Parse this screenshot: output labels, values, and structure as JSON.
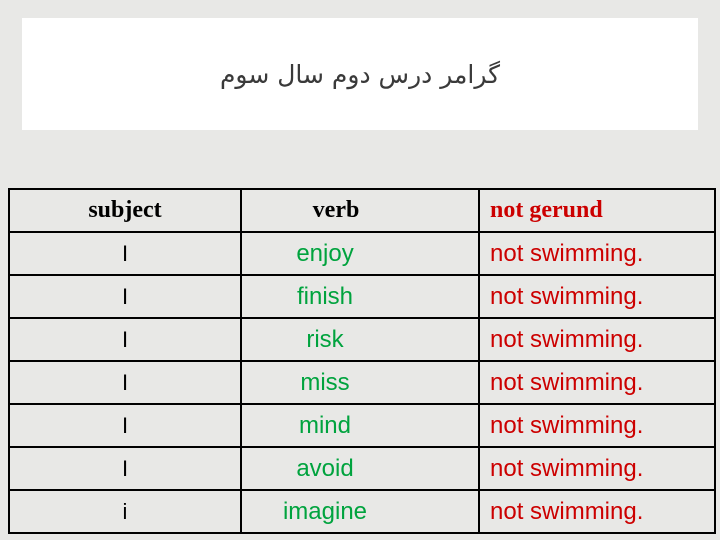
{
  "slide": {
    "title": "گرامر درس دوم سال سوم",
    "background_color": "#e8e8e6",
    "title_band_color": "#ffffff"
  },
  "table": {
    "headers": {
      "subject": "subject",
      "verb": "verb",
      "object": "not gerund"
    },
    "header_colors": {
      "subject": "#000000",
      "verb": "#000000",
      "object": "#cc0000"
    },
    "cell_colors": {
      "subject": "#000000",
      "verb": "#00a33e",
      "object": "#cc0000"
    },
    "rows": [
      {
        "subject": "I",
        "verb": "enjoy",
        "object": "not swimming."
      },
      {
        "subject": "I",
        "verb": "finish",
        "object": "not swimming."
      },
      {
        "subject": "I",
        "verb": "risk",
        "object": "not swimming."
      },
      {
        "subject": "I",
        "verb": "miss",
        "object": "not swimming."
      },
      {
        "subject": "I",
        "verb": "mind",
        "object": "not swimming."
      },
      {
        "subject": "I",
        "verb": "avoid",
        "object": "not swimming."
      },
      {
        "subject": "i",
        "verb": "imagine",
        "object": "not swimming."
      }
    ]
  }
}
